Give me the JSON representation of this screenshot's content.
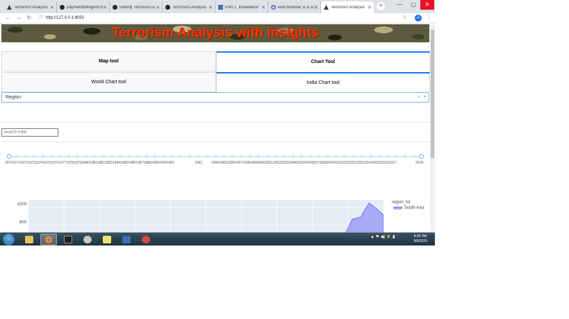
{
  "browser": {
    "tabs": [
      {
        "title": "Terrorism Analysis",
        "icon": "plotly-icon",
        "active": false
      },
      {
        "title": "paymentbilling/README",
        "icon": "github-icon",
        "active": false
      },
      {
        "title": "Editing Terrorism-A",
        "icon": "github-icon",
        "active": false
      },
      {
        "title": "Terrorism-Analysis",
        "icon": "github-icon",
        "active": false
      },
      {
        "title": "Part 1. Installation",
        "icon": "document-icon",
        "active": false
      },
      {
        "title": "web browser is a soft",
        "icon": "google-icon",
        "active": false
      },
      {
        "title": "Terrorism Analysis",
        "icon": "plotly-icon",
        "active": true
      }
    ],
    "new_tab_label": "+",
    "url": "http://127.0.0.1:8050",
    "profile_initial": "A"
  },
  "app": {
    "banner_title": "Terrorism Analysis with Insights",
    "tabs": {
      "map_tool": "Map tool",
      "chart_tool": "Chart Tool",
      "world_chart": "World Chart tool",
      "india_chart": "India Chart tool"
    },
    "region_dropdown": {
      "value": "Region",
      "clear": "×",
      "arrow": "▾"
    },
    "search_filter": {
      "placeholder": "Search Filter",
      "value": ""
    },
    "year_slider": {
      "range": [
        1970,
        2018
      ],
      "labels_left": "1970197119721973197419751976197719781979198019811982198319841985198619871988198919901991",
      "labels_mid": "1992",
      "labels_right": "199419951996199719981999200020012002200320042005200620072008200920102011201220132014201520162017",
      "labels_end": "2018"
    }
  },
  "chart_data": {
    "type": "area",
    "yticks": [
      "1000",
      "800"
    ],
    "legend_title": "region_txt",
    "series": [
      {
        "name": "South Asia",
        "color": "#636efa",
        "visible_values_note": ""
      }
    ]
  },
  "taskbar": {
    "clock_time": "8:26 PM",
    "clock_date": "9/8/2020"
  }
}
